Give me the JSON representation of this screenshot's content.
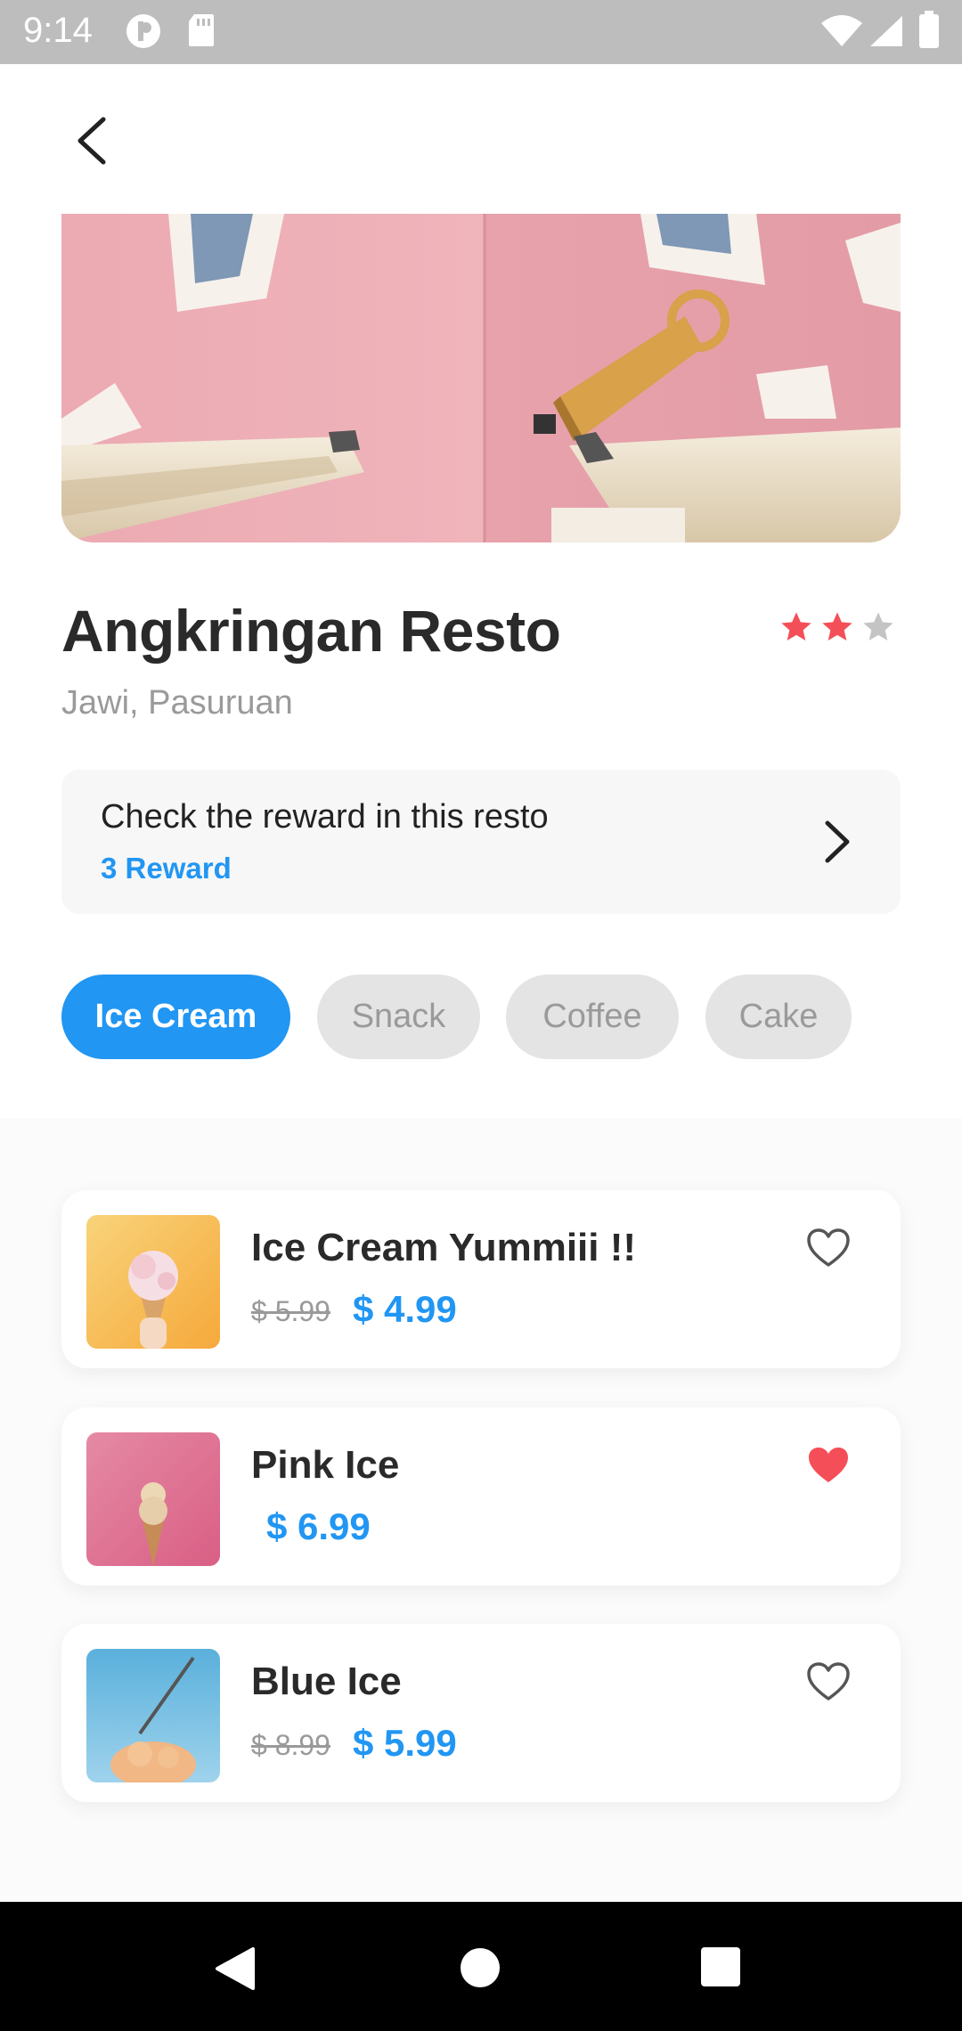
{
  "status_bar": {
    "time": "9:14"
  },
  "restaurant": {
    "name": "Angkringan Resto",
    "location": "Jawi, Pasuruan",
    "rating": 2,
    "rating_max": 3
  },
  "reward": {
    "text": "Check the reward in this resto",
    "count": "3 Reward"
  },
  "categories": [
    {
      "label": "Ice Cream",
      "active": true
    },
    {
      "label": "Snack",
      "active": false
    },
    {
      "label": "Coffee",
      "active": false
    },
    {
      "label": "Cake",
      "active": false
    }
  ],
  "items": [
    {
      "name": "Ice Cream Yummiii !!",
      "old_price": "$ 5.99",
      "price": "$ 4.99",
      "favorite": false
    },
    {
      "name": "Pink Ice",
      "old_price": "",
      "price": "$ 6.99",
      "favorite": true
    },
    {
      "name": "Blue Ice",
      "old_price": "$ 8.99",
      "price": "$ 5.99",
      "favorite": false
    }
  ],
  "colors": {
    "accent": "#2196f3",
    "star": "#f44f58",
    "heart": "#f44f58"
  }
}
